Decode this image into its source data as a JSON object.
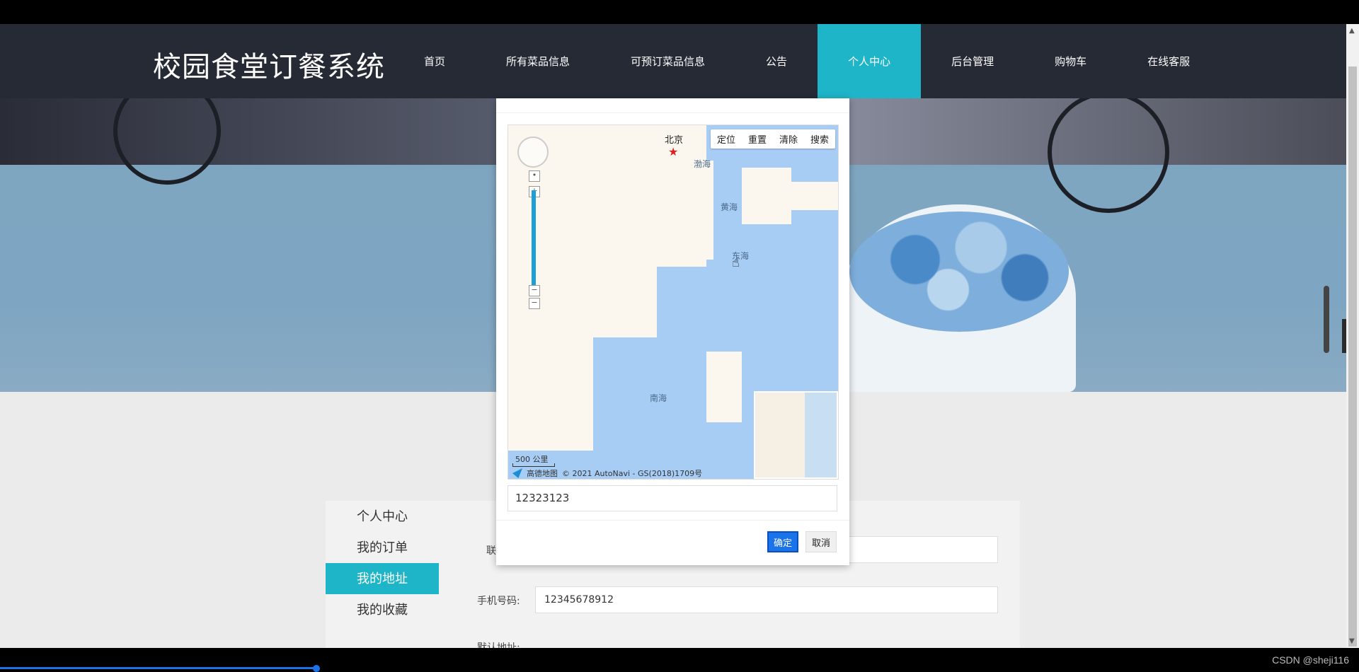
{
  "header": {
    "brand": "校园食堂订餐系统",
    "nav": [
      {
        "label": "首页",
        "active": false
      },
      {
        "label": "所有菜品信息",
        "active": false
      },
      {
        "label": "可预订菜品信息",
        "active": false
      },
      {
        "label": "公告",
        "active": false
      },
      {
        "label": "个人中心",
        "active": true
      },
      {
        "label": "后台管理",
        "active": false
      },
      {
        "label": "购物车",
        "active": false
      },
      {
        "label": "在线客服",
        "active": false
      }
    ]
  },
  "sidebar": {
    "items": [
      {
        "label": "个人中心"
      },
      {
        "label": "我的订单"
      },
      {
        "label": "我的地址"
      },
      {
        "label": "我的收藏"
      }
    ]
  },
  "form": {
    "label_contact_partial": "联",
    "phone_label": "手机号码:",
    "phone_value": "12345678912",
    "default_label_partial": "默认地址:"
  },
  "dialog": {
    "toolbar": [
      "定位",
      "重置",
      "清除",
      "搜索"
    ],
    "map_labels": {
      "beijing": "北京",
      "bohai": "渤海",
      "huanghai": "黄海",
      "donghai": "东海",
      "nanhai": "南海"
    },
    "scale": "500 公里",
    "provider": "高德地图",
    "copyright": "© 2021 AutoNavi - GS(2018)1709号",
    "address_value": "12323123",
    "ok_label": "确定",
    "cancel_label": "取消"
  },
  "footer": {
    "credit": "CSDN @sheji116"
  },
  "colors": {
    "header_bg": "#262a35",
    "accent": "#1fb5c8",
    "primary_button": "#1a73e8"
  }
}
